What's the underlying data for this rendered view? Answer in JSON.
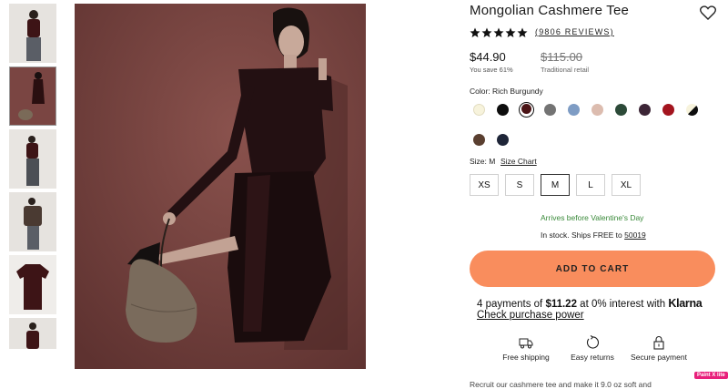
{
  "product": {
    "title": "Mongolian Cashmere Tee",
    "rating_stars": 5,
    "reviews_label": "(9806 REVIEWS)",
    "price": "$44.90",
    "savings": "You save 61%",
    "original_price": "$115.00",
    "original_price_label": "Traditional retail"
  },
  "colors": {
    "label": "Color: Rich Burgundy",
    "swatches": [
      {
        "name": "ivory",
        "hex": "#f7f3dc"
      },
      {
        "name": "black",
        "hex": "#0d0d0d"
      },
      {
        "name": "rich-burgundy",
        "hex": "#4a1416",
        "selected": true
      },
      {
        "name": "charcoal-grey",
        "hex": "#737373"
      },
      {
        "name": "light-blue",
        "hex": "#7e9cc4"
      },
      {
        "name": "blush",
        "hex": "#dcbcaf"
      },
      {
        "name": "forest-green",
        "hex": "#2c4a38"
      },
      {
        "name": "aubergine",
        "hex": "#3c2536"
      },
      {
        "name": "red",
        "hex": "#a3141e"
      },
      {
        "name": "black-ivory",
        "hex": "#0d0d0d"
      },
      {
        "name": "brown",
        "hex": "#5a3f30"
      },
      {
        "name": "navy",
        "hex": "#1e2538"
      }
    ]
  },
  "sizes": {
    "label": "Size: M",
    "chart_label": "Size Chart",
    "options": [
      "XS",
      "S",
      "M",
      "L",
      "XL"
    ],
    "selected": "M"
  },
  "delivery": {
    "arrives": "Arrives before Valentine's Day",
    "stock_prefix": "In stock. Ships FREE to ",
    "zip": "50019"
  },
  "cart": {
    "label": "ADD TO CART"
  },
  "klarna": {
    "prefix": "4 payments of ",
    "amount": "$11.22",
    "middle": " at 0% interest with ",
    "brand": "Klarna",
    "link": "Check purchase power"
  },
  "perks": [
    {
      "icon": "truck-icon",
      "label": "Free shipping"
    },
    {
      "icon": "returns-icon",
      "label": "Easy returns"
    },
    {
      "icon": "lock-icon",
      "label": "Secure payment"
    }
  ],
  "cutoff_text": "Recruit our cashmere tee and make it 9.0 oz soft and",
  "badge": "Paint X lite",
  "colors_palette": {
    "accent": "#f98d5d",
    "green": "#3a8a3a",
    "backdrop": "#7a4542"
  }
}
